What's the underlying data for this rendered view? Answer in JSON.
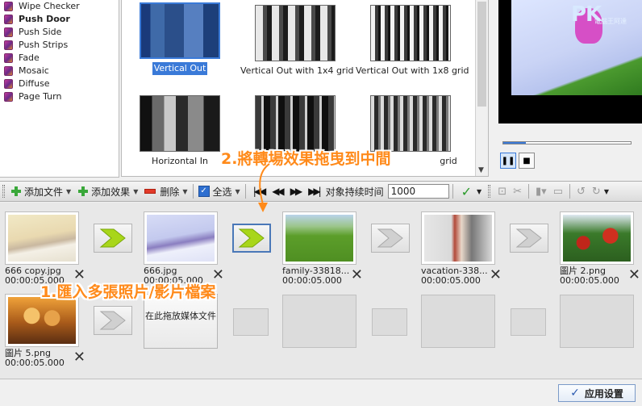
{
  "transitions_list": [
    {
      "label": "Wipe Checker",
      "bold": false
    },
    {
      "label": "Push Door",
      "bold": true
    },
    {
      "label": "Push Side",
      "bold": false
    },
    {
      "label": "Push Strips",
      "bold": false
    },
    {
      "label": "Fade",
      "bold": false
    },
    {
      "label": "Mosaic",
      "bold": false
    },
    {
      "label": "Diffuse",
      "bold": false
    },
    {
      "label": "Page Turn",
      "bold": false
    }
  ],
  "gallery": [
    {
      "label": "Vertical Out",
      "selected": true
    },
    {
      "label": "Vertical Out with 1x4 grid",
      "selected": false
    },
    {
      "label": "Vertical Out with 1x8 grid",
      "selected": false
    },
    {
      "label": "Horizontal In",
      "selected": false
    },
    {
      "label": "",
      "selected": false
    },
    {
      "label": "grid",
      "selected": false
    }
  ],
  "preview": {
    "logo": "PK",
    "logo_sub": "電腦王阿達"
  },
  "toolbar": {
    "add_file": "添加文件",
    "add_effect": "添加效果",
    "delete": "删除",
    "select_all": "全选",
    "duration_label": "对象持续时间",
    "duration_value": "1000"
  },
  "storyboard": {
    "row1": [
      {
        "name": "666 copy.jpg",
        "time": "00:00:05.000"
      },
      {
        "name": "666.jpg",
        "time": "00:00:05.000"
      },
      {
        "name": "family-33818...",
        "time": "00:00:05.000"
      },
      {
        "name": "vacation-338...",
        "time": "00:00:05.000"
      },
      {
        "name": "圖片 2.png",
        "time": "00:00:05.000"
      }
    ],
    "row2": [
      {
        "name": "圖片 5.png",
        "time": "00:00:05.000"
      }
    ],
    "dropzone": "在此拖放媒体文件"
  },
  "annotations": {
    "step1": "1.匯入多張照片/影片檔案",
    "step2": "2.將轉場效果拖曳到中間"
  },
  "apply_button": "应用设置",
  "colors": {
    "accent": "#3a7ad8",
    "annotation": "#ff8a1a",
    "arrow_green": "#a8d61a"
  }
}
